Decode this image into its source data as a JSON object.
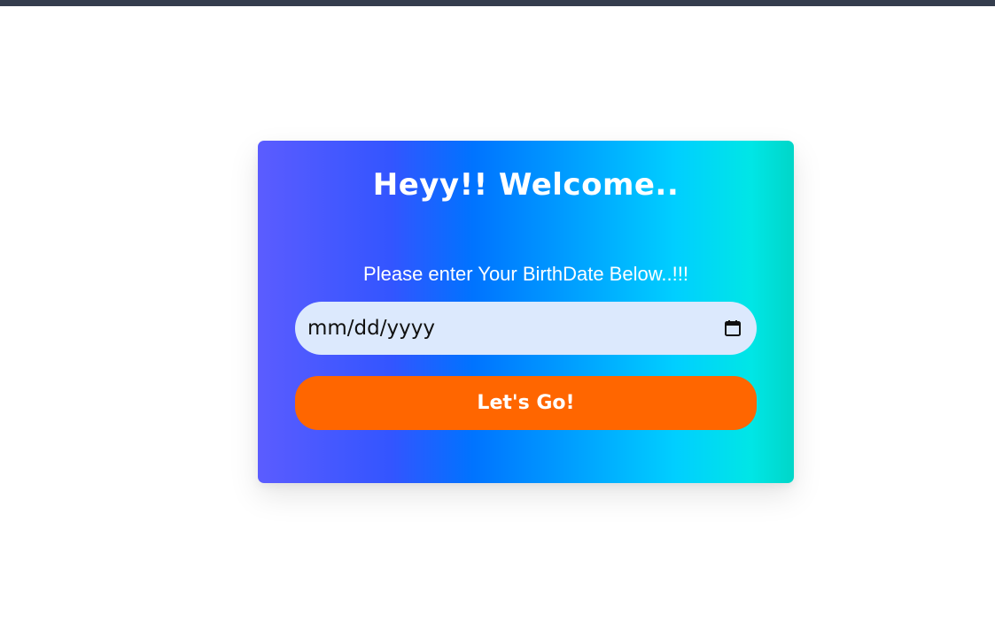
{
  "card": {
    "title": "Heyy!! Welcome..",
    "prompt": "Please enter Your BirthDate Below..!!!"
  },
  "birthdate": {
    "placeholder": "mm/dd/yyyy",
    "icon": "calendar-icon"
  },
  "submit": {
    "label": "Let's Go!"
  },
  "colors": {
    "top_bar": "#343d4d",
    "gradient_start": "#5b5cff",
    "gradient_mid": "#0073ff",
    "gradient_end": "#00d6c8",
    "input_background": "#dce9fd",
    "button_background": "#ff6600",
    "text": "#ffffff"
  }
}
